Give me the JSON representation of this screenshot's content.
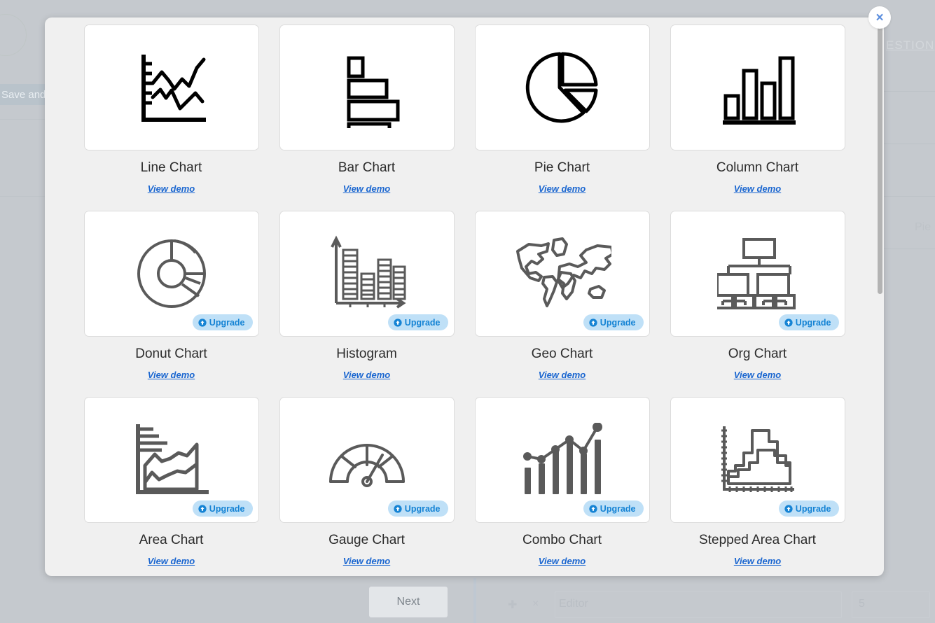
{
  "background": {
    "save_button_label": "Save and c",
    "question_label": "ESTION",
    "pie_label": "Pie",
    "next_button_label": "Next",
    "editor_placeholder": "Editor",
    "count_value": "5",
    "move_icon": "move-icon",
    "close_row_icon": "close-icon"
  },
  "modal": {
    "close_icon": "close-icon",
    "close_glyph": "×",
    "scrollbar": "vertical-scrollbar",
    "view_demo_label": "View demo",
    "upgrade_label": "Upgrade",
    "colors": {
      "modal_bg": "#f0f0f0",
      "card_bg": "#ffffff",
      "card_border": "#dcdcdc",
      "link_blue": "#1a66d0",
      "upgrade_bg": "#bfe0f7",
      "upgrade_text": "#1583d4",
      "icon_dark": "#000000",
      "icon_gray": "#5a5a5a",
      "close_blue": "#5b8ede",
      "backdrop": "#c5c9ce"
    },
    "cards": [
      {
        "id": "line-chart",
        "title": "Line Chart",
        "icon": "line-chart-icon",
        "demo": "View demo",
        "upgrade": false
      },
      {
        "id": "bar-chart",
        "title": "Bar Chart",
        "icon": "bar-chart-icon",
        "demo": "View demo",
        "upgrade": false
      },
      {
        "id": "pie-chart",
        "title": "Pie Chart",
        "icon": "pie-chart-icon",
        "demo": "View demo",
        "upgrade": false
      },
      {
        "id": "column-chart",
        "title": "Column Chart",
        "icon": "column-chart-icon",
        "demo": "View demo",
        "upgrade": false
      },
      {
        "id": "donut-chart",
        "title": "Donut Chart",
        "icon": "donut-chart-icon",
        "demo": "View demo",
        "upgrade": true
      },
      {
        "id": "histogram",
        "title": "Histogram",
        "icon": "histogram-icon",
        "demo": "View demo",
        "upgrade": true
      },
      {
        "id": "geo-chart",
        "title": "Geo Chart",
        "icon": "geo-chart-icon",
        "demo": "View demo",
        "upgrade": true
      },
      {
        "id": "org-chart",
        "title": "Org Chart",
        "icon": "org-chart-icon",
        "demo": "View demo",
        "upgrade": true
      },
      {
        "id": "area-chart",
        "title": "Area Chart",
        "icon": "area-chart-icon",
        "demo": "View demo",
        "upgrade": true
      },
      {
        "id": "gauge-chart",
        "title": "Gauge Chart",
        "icon": "gauge-chart-icon",
        "demo": "View demo",
        "upgrade": true
      },
      {
        "id": "combo-chart",
        "title": "Combo Chart",
        "icon": "combo-chart-icon",
        "demo": "View demo",
        "upgrade": true
      },
      {
        "id": "stepped-area-chart",
        "title": "Stepped Area Chart",
        "icon": "stepped-area-chart-icon",
        "demo": "View demo",
        "upgrade": true
      }
    ]
  }
}
